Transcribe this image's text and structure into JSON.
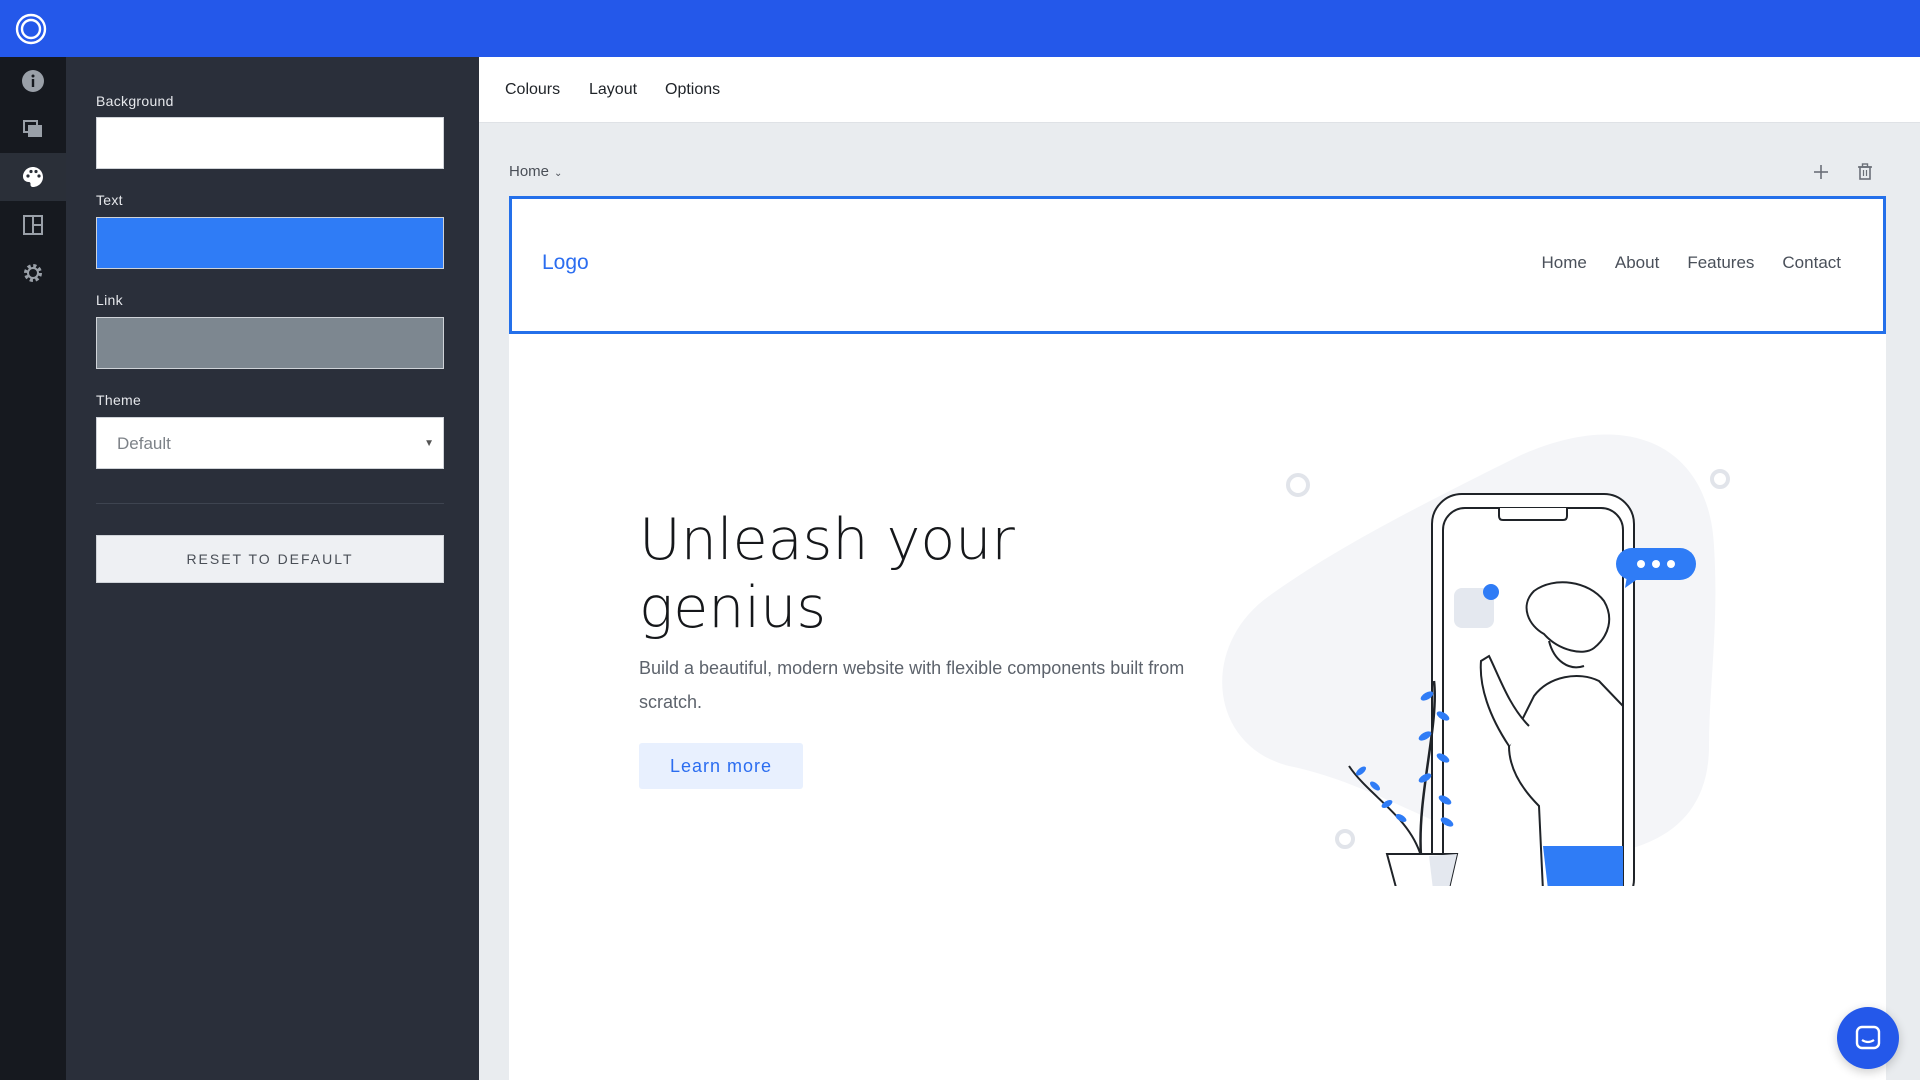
{
  "app": {
    "brand_color": "#2458ea",
    "rail_icons": [
      "info-icon",
      "pages-icon",
      "palette-icon",
      "layout-icon",
      "settings-icon"
    ],
    "active_rail_icon": "palette-icon"
  },
  "panel": {
    "background_label": "Background",
    "background_color": "#ffffff",
    "text_label": "Text",
    "text_color": "#2f7cf6",
    "link_label": "Link",
    "link_color": "#7d8790",
    "theme_label": "Theme",
    "theme_value": "Default",
    "reset_label": "RESET TO DEFAULT"
  },
  "tabs": {
    "colours": "Colours",
    "layout": "Layout",
    "options": "Options"
  },
  "canvas": {
    "page_name": "Home",
    "add_icon": "plus-icon",
    "delete_icon": "trash-icon"
  },
  "site": {
    "logo": "Logo",
    "nav": [
      "Home",
      "About",
      "Features",
      "Contact"
    ],
    "hero_title": "Unleash your genius",
    "hero_subtitle": "Build a beautiful, modern website with flexible components built from scratch.",
    "hero_button": "Learn more",
    "accent_color": "#2b6df0"
  }
}
